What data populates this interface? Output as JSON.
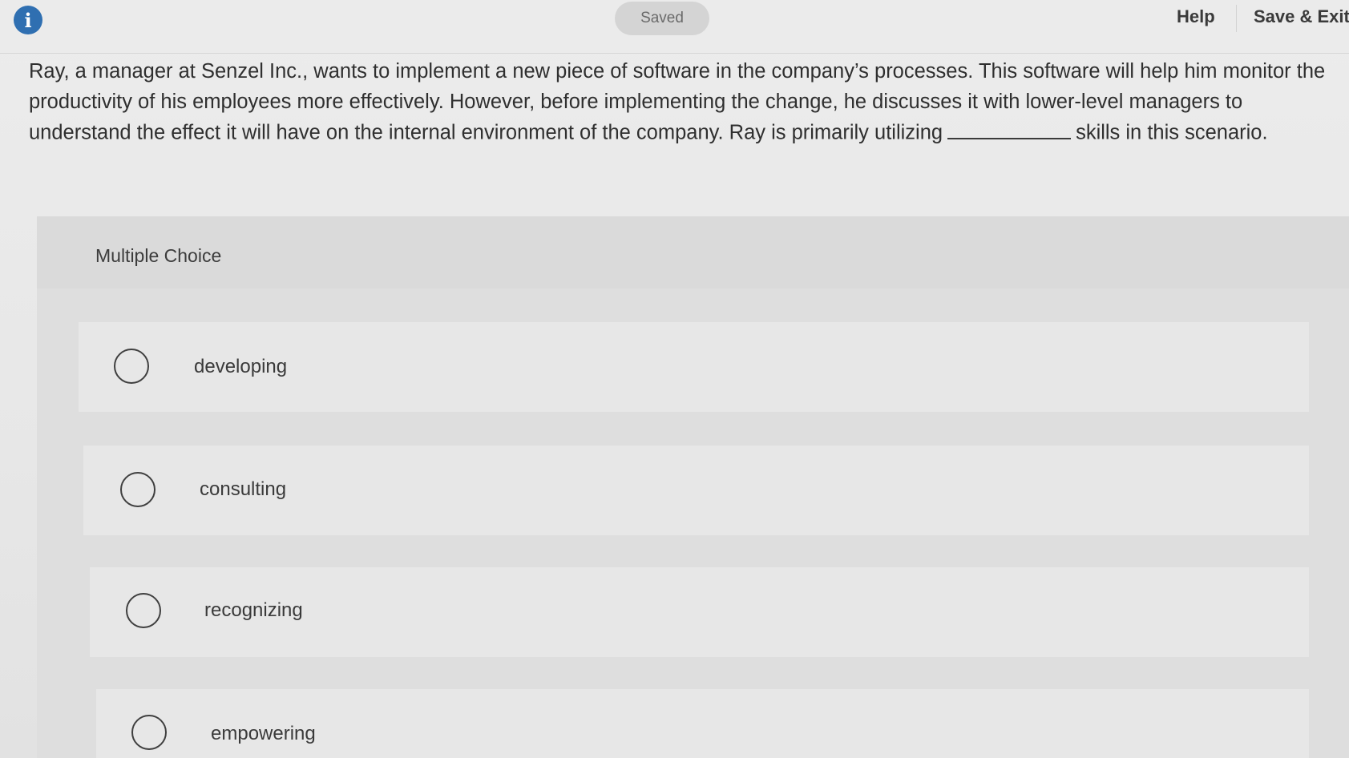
{
  "header": {
    "info_icon": "info-icon",
    "saved_label": "Saved",
    "help_label": "Help",
    "save_exit_label": "Save & Exit"
  },
  "question": {
    "text_before_blank": "Ray, a manager at Senzel Inc., wants to implement a new piece of software in the company’s processes. This software will help him monitor the productivity of his employees more effectively. However, before implementing the change, he discusses it with lower-level managers to understand the effect it will have on the internal environment of the company. Ray is primarily utilizing",
    "text_after_blank": "skills in this scenario."
  },
  "multiple_choice": {
    "label": "Multiple Choice",
    "options": [
      {
        "label": "developing"
      },
      {
        "label": "consulting"
      },
      {
        "label": "recognizing"
      },
      {
        "label": "empowering"
      }
    ]
  },
  "colors": {
    "accent": "#2f6fb1",
    "background": "#e9e9e9"
  }
}
